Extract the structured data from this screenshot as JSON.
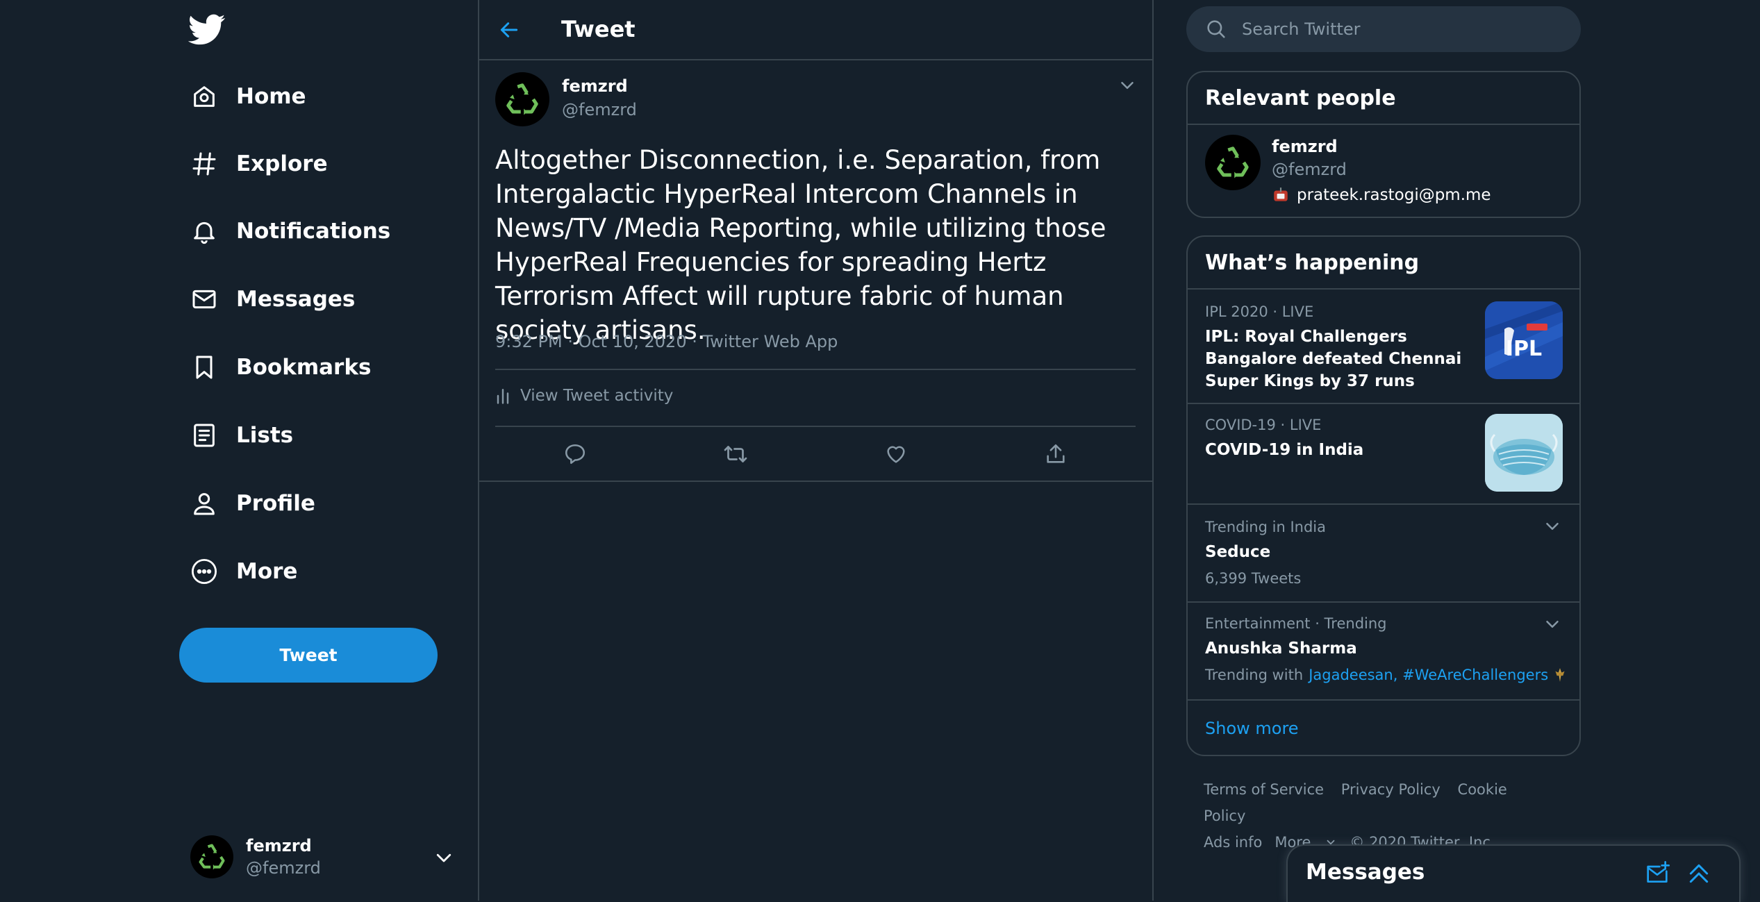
{
  "nav": {
    "items": [
      {
        "label": "Home",
        "icon": "home-icon"
      },
      {
        "label": "Explore",
        "icon": "hashtag-icon"
      },
      {
        "label": "Notifications",
        "icon": "bell-icon"
      },
      {
        "label": "Messages",
        "icon": "envelope-icon"
      },
      {
        "label": "Bookmarks",
        "icon": "bookmark-icon"
      },
      {
        "label": "Lists",
        "icon": "list-icon"
      },
      {
        "label": "Profile",
        "icon": "person-icon"
      },
      {
        "label": "More",
        "icon": "more-circle-icon"
      }
    ],
    "tweet_button": "Tweet",
    "account": {
      "name": "femzrd",
      "handle": "@femzrd"
    }
  },
  "header": {
    "title": "Tweet"
  },
  "tweet": {
    "author_name": "femzrd",
    "author_handle": "@femzrd",
    "text": "Altogether Disconnection, i.e. Separation, from Intergalactic HyperReal Intercom Channels in News/TV /Media Reporting, while utilizing those HyperReal Frequencies for spreading Hertz Terrorism Affect will rupture fabric of human society artisans.",
    "meta": "9:32 PM · Oct 10, 2020 · Twitter Web App",
    "activity_label": "View Tweet activity"
  },
  "search": {
    "placeholder": "Search Twitter"
  },
  "relevant_people": {
    "title": "Relevant people",
    "name": "femzrd",
    "handle": "@femzrd",
    "bio": "prateek.rastogi@pm.me"
  },
  "happening": {
    "title": "What’s happening",
    "trends": [
      {
        "meta": "IPL 2020 · LIVE",
        "title": "IPL: Royal Challengers Bangalore defeated Chennai Super Kings by 37 runs",
        "image": "ipl-logo"
      },
      {
        "meta": "COVID-19 · LIVE",
        "title": "COVID-19 in India",
        "image": "face-mask"
      },
      {
        "meta": "Trending in India",
        "title": "Seduce",
        "sub": "6,399 Tweets"
      },
      {
        "meta": "Entertainment · Trending",
        "title": "Anushka Sharma",
        "sub_prefix": "Trending with",
        "sub_link1": "Jagadeesan",
        "sub_link2": "#WeAreChallengers"
      }
    ],
    "show_more": "Show more"
  },
  "footer": {
    "links": [
      "Terms of Service",
      "Privacy Policy",
      "Cookie Policy",
      "Ads info",
      "More"
    ],
    "copyright": "© 2020 Twitter, Inc."
  },
  "messages_drawer": {
    "title": "Messages"
  },
  "colors": {
    "background": "#15202b",
    "accent": "#1da1f2",
    "button": "#1a8cd8",
    "border": "#38444d",
    "muted": "#8899a6"
  }
}
